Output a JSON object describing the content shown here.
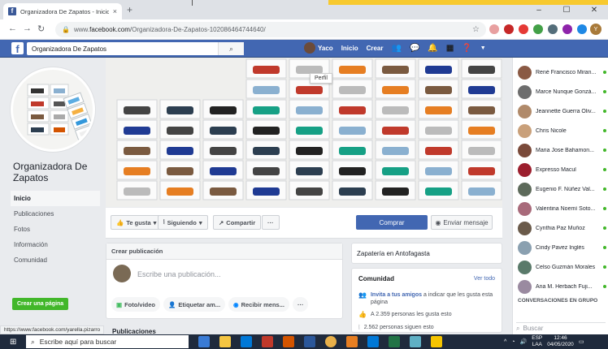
{
  "browser": {
    "tab_title": "Organizadora De Zapatos - Inicio",
    "tab_close": "×",
    "new_tab": "+",
    "url_host": "facebook.com",
    "url_path": "/Organizadora-De-Zapatos-102086464744640/",
    "url_prefix": "www.",
    "min": "–",
    "max": "☐",
    "close": "✕",
    "profile_initial": "Y"
  },
  "fbbar": {
    "search_value": "Organizadora De Zapatos",
    "nav_user": "Yaco",
    "nav_home": "Inicio",
    "nav_create": "Crear",
    "tooltip": "Perfil"
  },
  "page": {
    "name": "Organizadora De Zapatos",
    "nav": [
      {
        "label": "Inicio"
      },
      {
        "label": "Publicaciones"
      },
      {
        "label": "Fotos"
      },
      {
        "label": "Información"
      },
      {
        "label": "Comunidad"
      }
    ],
    "create_page_btn": "Crear una página"
  },
  "actions": {
    "like": "Te gusta",
    "follow": "Siguiendo",
    "share": "Compartir",
    "more": "···",
    "buy": "Comprar",
    "message": "Enviar mensaje"
  },
  "createpost": {
    "header": "Crear publicación",
    "placeholder": "Escribe una publicación...",
    "photo": "Foto/video",
    "tag": "Etiquetar am...",
    "messages": "Recibir mens...",
    "more": "···"
  },
  "publications_label": "Publicaciones",
  "info": {
    "category": "Zapatería en Antofagasta",
    "community_title": "Comunidad",
    "see_all": "Ver todo",
    "invite_link": "Invita a tus amigos",
    "invite_rest": " a indicar que les gusta esta página",
    "likes": "A 2.359 personas les gusta esto",
    "follows": "2.562 personas siguen esto"
  },
  "chat": {
    "contacts": [
      {
        "name": "René Francisco Miran...",
        "color": "#8a5a44"
      },
      {
        "name": "Marce Ñunque Gonzá...",
        "color": "#6d6d6d"
      },
      {
        "name": "Jeannette Guerra Oliv...",
        "color": "#b08a6a"
      },
      {
        "name": "Chris Nicole",
        "color": "#c9a07a"
      },
      {
        "name": "Maria Jose Bahamon...",
        "color": "#7a4a3a"
      },
      {
        "name": "Expresso Macul",
        "color": "#9c1f2e"
      },
      {
        "name": "Eugenio F. Núñez Val...",
        "color": "#5d6a5a"
      },
      {
        "name": "Valentina Noemí Soto...",
        "color": "#a86a7a"
      },
      {
        "name": "Cynthia Paz Muñoz",
        "color": "#6a5a4a"
      },
      {
        "name": "Cindy Pavez Inglés",
        "color": "#8aa0b0"
      },
      {
        "name": "Celso Guzmán Morales",
        "color": "#5a7a6a"
      },
      {
        "name": "Ana M. Herbach Fuji...",
        "color": "#9a8aa0"
      }
    ],
    "group_header": "CONVERSACIONES EN GRUPO",
    "search_placeholder": "Buscar"
  },
  "status_url": "https://www.facebook.com/yarella.pizarro",
  "taskbar": {
    "search_placeholder": "Escribe aquí para buscar",
    "lang": "ESP",
    "lang2": "LAA",
    "time": "12:46",
    "date": "04/05/2020"
  }
}
